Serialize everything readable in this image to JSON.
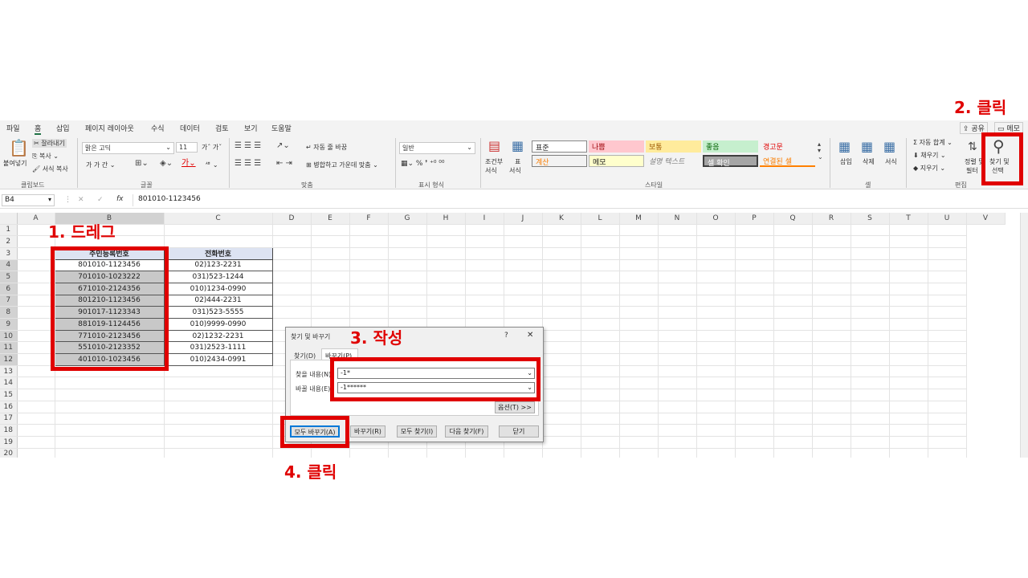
{
  "menu": [
    "파일",
    "홈",
    "삽입",
    "페이지 레이아웃",
    "수식",
    "데이터",
    "검토",
    "보기",
    "도움말"
  ],
  "share": "공유",
  "memo": "메모",
  "ribbon": {
    "paste": "붙여넣기",
    "cut": "잘라내기",
    "copy": "복사",
    "format_painter": "서식 복사",
    "clipboard": "클립보드",
    "font_name": "맑은 고딕",
    "font_size": "11",
    "font_group": "글꼴",
    "wrap": "자동 줄 바꿈",
    "merge": "병합하고 가운데 맞춤",
    "align_group": "맞춤",
    "number_format": "일반",
    "number_group": "표시 형식",
    "cond": "조건부",
    "cond2": "서식",
    "table": "표",
    "table2": "서식",
    "styles": [
      "표준",
      "나쁨",
      "보통",
      "좋음",
      "경고문",
      "계산",
      "메모",
      "설명 텍스트",
      "셀 확인",
      "연결된 셀"
    ],
    "style_group": "스타일",
    "insert": "삽입",
    "delete": "삭제",
    "format": "서식",
    "cells_group": "셀",
    "autosum": "자동 합계",
    "fill": "채우기",
    "clear": "지우기",
    "sort": "정렬 및",
    "sort2": "필터",
    "find": "찾기 및",
    "find2": "선택",
    "edit_group": "편집"
  },
  "namebox": "B4",
  "formula": "801010-1123456",
  "columns": [
    "A",
    "B",
    "C",
    "D",
    "E",
    "F",
    "G",
    "H",
    "I",
    "J",
    "K",
    "L",
    "M",
    "N",
    "O",
    "P",
    "Q",
    "R",
    "S",
    "T",
    "U",
    "V"
  ],
  "rows": [
    "1",
    "2",
    "3",
    "4",
    "5",
    "6",
    "7",
    "8",
    "9",
    "10",
    "11",
    "12",
    "13",
    "14",
    "15",
    "16",
    "17",
    "18",
    "19",
    "20"
  ],
  "table": {
    "headers": [
      "주민등록번호",
      "전화번호"
    ],
    "data": [
      [
        "801010-1123456",
        "02)123-2231"
      ],
      [
        "701010-1023222",
        "031)523-1244"
      ],
      [
        "671010-2124356",
        "010)1234-0990"
      ],
      [
        "801210-1123456",
        "02)444-2231"
      ],
      [
        "901017-1123343",
        "031)523-5555"
      ],
      [
        "881019-1124456",
        "010)9999-0990"
      ],
      [
        "771010-2123456",
        "02)1232-2231"
      ],
      [
        "551010-2123352",
        "031)2523-1111"
      ],
      [
        "401010-1023456",
        "010)2434-0991"
      ]
    ]
  },
  "dialog": {
    "title": "찾기 및 바꾸기",
    "help": "?",
    "close": "✕",
    "tab_find": "찾기(D)",
    "tab_replace": "바꾸기(P)",
    "find_label": "찾을 내용(N):",
    "find_value": "-1*",
    "replace_label": "바꿀 내용(E):",
    "replace_value": "-1******",
    "options": "옵션(T) >>",
    "replace_all": "모두 바꾸기(A)",
    "replace": "바꾸기(R)",
    "find_all": "모두 찾기(I)",
    "find_next": "다음 찾기(F)",
    "close_btn": "닫기"
  },
  "annotations": {
    "a1": "1. 드레그",
    "a2": "2. 클릭",
    "a3": "3. 작성",
    "a4": "4. 클릭"
  }
}
